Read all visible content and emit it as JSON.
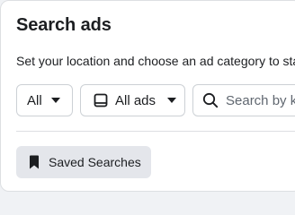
{
  "header": {
    "title": "Search ads",
    "subtitle": "Set your location and choose an ad category to start your search."
  },
  "filters": {
    "country": {
      "selected": "All",
      "icon": "chevron-down-icon"
    },
    "ad_type": {
      "selected": "All ads",
      "icon": "ad-category-icon"
    },
    "search": {
      "placeholder": "Search by keyword or advertiser",
      "value": "",
      "icon": "search-icon"
    }
  },
  "saved_searches": {
    "label": "Saved Searches",
    "icon": "bookmark-icon"
  },
  "colors": {
    "background": "#ffffff",
    "border": "#ccd0d5",
    "text": "#1c1e21",
    "button_bg": "#e4e6eb"
  }
}
